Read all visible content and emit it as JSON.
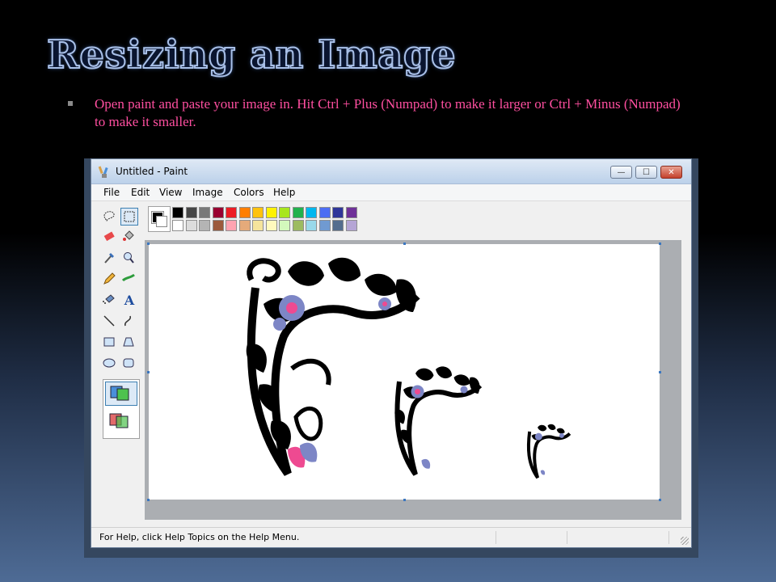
{
  "slide": {
    "title": "Resizing an Image",
    "bullet": "Open paint and paste your image in. Hit Ctrl + Plus (Numpad) to make it larger or Ctrl + Minus (Numpad) to make it smaller."
  },
  "window": {
    "title": "Untitled - Paint",
    "controls": {
      "minimize": "—",
      "maximize": "☐",
      "close": "✕"
    },
    "menu": [
      "File",
      "Edit",
      "View",
      "Image",
      "Colors",
      "Help"
    ],
    "status_text": "For Help, click Help Topics on the Help Menu."
  },
  "tools": [
    {
      "name": "free-form-select-icon"
    },
    {
      "name": "select-icon"
    },
    {
      "name": "eraser-icon"
    },
    {
      "name": "fill-bucket-icon"
    },
    {
      "name": "color-picker-icon"
    },
    {
      "name": "magnifier-icon"
    },
    {
      "name": "pencil-icon"
    },
    {
      "name": "brush-icon"
    },
    {
      "name": "airbrush-icon"
    },
    {
      "name": "text-icon",
      "glyph": "A"
    },
    {
      "name": "line-icon"
    },
    {
      "name": "curve-icon"
    },
    {
      "name": "rectangle-icon"
    },
    {
      "name": "polygon-icon"
    },
    {
      "name": "ellipse-icon"
    },
    {
      "name": "rounded-rectangle-icon"
    }
  ],
  "palette": {
    "foreground": "#000000",
    "background": "#ffffff",
    "colors": [
      "#000000",
      "#464646",
      "#787878",
      "#990030",
      "#ed1c24",
      "#ff7e00",
      "#ffc20e",
      "#fff200",
      "#a8e61d",
      "#22b14c",
      "#00b7ef",
      "#4d6df3",
      "#2f3699",
      "#6f3198",
      "#ffffff",
      "#dcdcdc",
      "#b4b4b4",
      "#9c5a3c",
      "#ffa3b1",
      "#e5aa7a",
      "#f5e49c",
      "#fff9bd",
      "#d3f9bc",
      "#9dbb61",
      "#99d9ea",
      "#709ad1",
      "#546d8e",
      "#b5a5d5"
    ]
  },
  "colors": {
    "title_stroke": "#a9c0e8",
    "bullet_text": "#ff4fa0",
    "ornament_purple": "#7d86c6",
    "ornament_pink": "#ee4a91"
  }
}
